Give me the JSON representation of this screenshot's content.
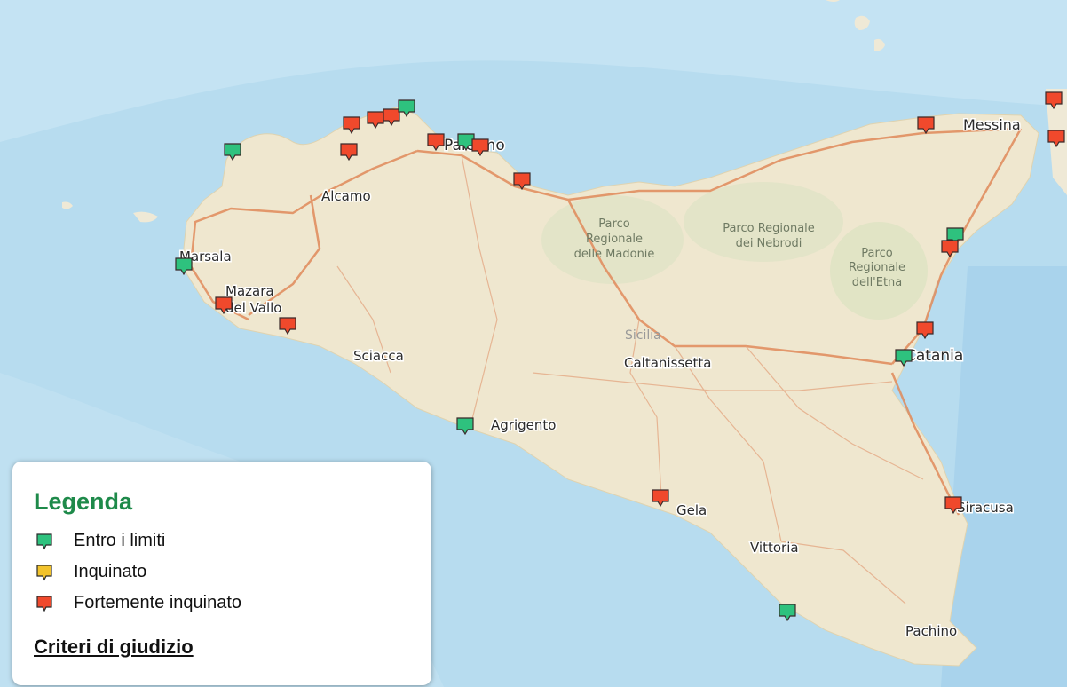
{
  "map": {
    "places": [
      {
        "key": "messina",
        "name": "Messina"
      },
      {
        "key": "palermo",
        "name": "Palermo"
      },
      {
        "key": "alcamo",
        "name": "Alcamo"
      },
      {
        "key": "marsala",
        "name": "Marsala"
      },
      {
        "key": "mazara1",
        "name": "Mazara"
      },
      {
        "key": "mazara2",
        "name": "del Vallo"
      },
      {
        "key": "sciacca",
        "name": "Sciacca"
      },
      {
        "key": "caltanissetta",
        "name": "Caltanissetta"
      },
      {
        "key": "agrigento",
        "name": "Agrigento"
      },
      {
        "key": "gela",
        "name": "Gela"
      },
      {
        "key": "vittoria",
        "name": "Vittoria"
      },
      {
        "key": "catania",
        "name": "Catania"
      },
      {
        "key": "siracusa",
        "name": "Siracusa"
      },
      {
        "key": "pachino",
        "name": "Pachino"
      }
    ],
    "region_label": "Sicilia",
    "parks": {
      "madonie": [
        "Parco",
        "Regionale",
        "delle Madonie"
      ],
      "nebrodi": [
        "Parco Regionale",
        "dei Nebrodi"
      ],
      "etna": [
        "Parco",
        "Regionale",
        "dell'Etna"
      ]
    },
    "marker_colors": {
      "entro": "#2ec27e",
      "inquinato": "#f2c32c",
      "forte": "#f0492c"
    }
  },
  "legend": {
    "title": "Legenda",
    "items": [
      {
        "label": "Entro i limiti",
        "status": "entro"
      },
      {
        "label": "Inquinato",
        "status": "inquinato"
      },
      {
        "label": "Fortemente inquinato",
        "status": "forte"
      }
    ],
    "link": "Criteri di giudizio"
  }
}
